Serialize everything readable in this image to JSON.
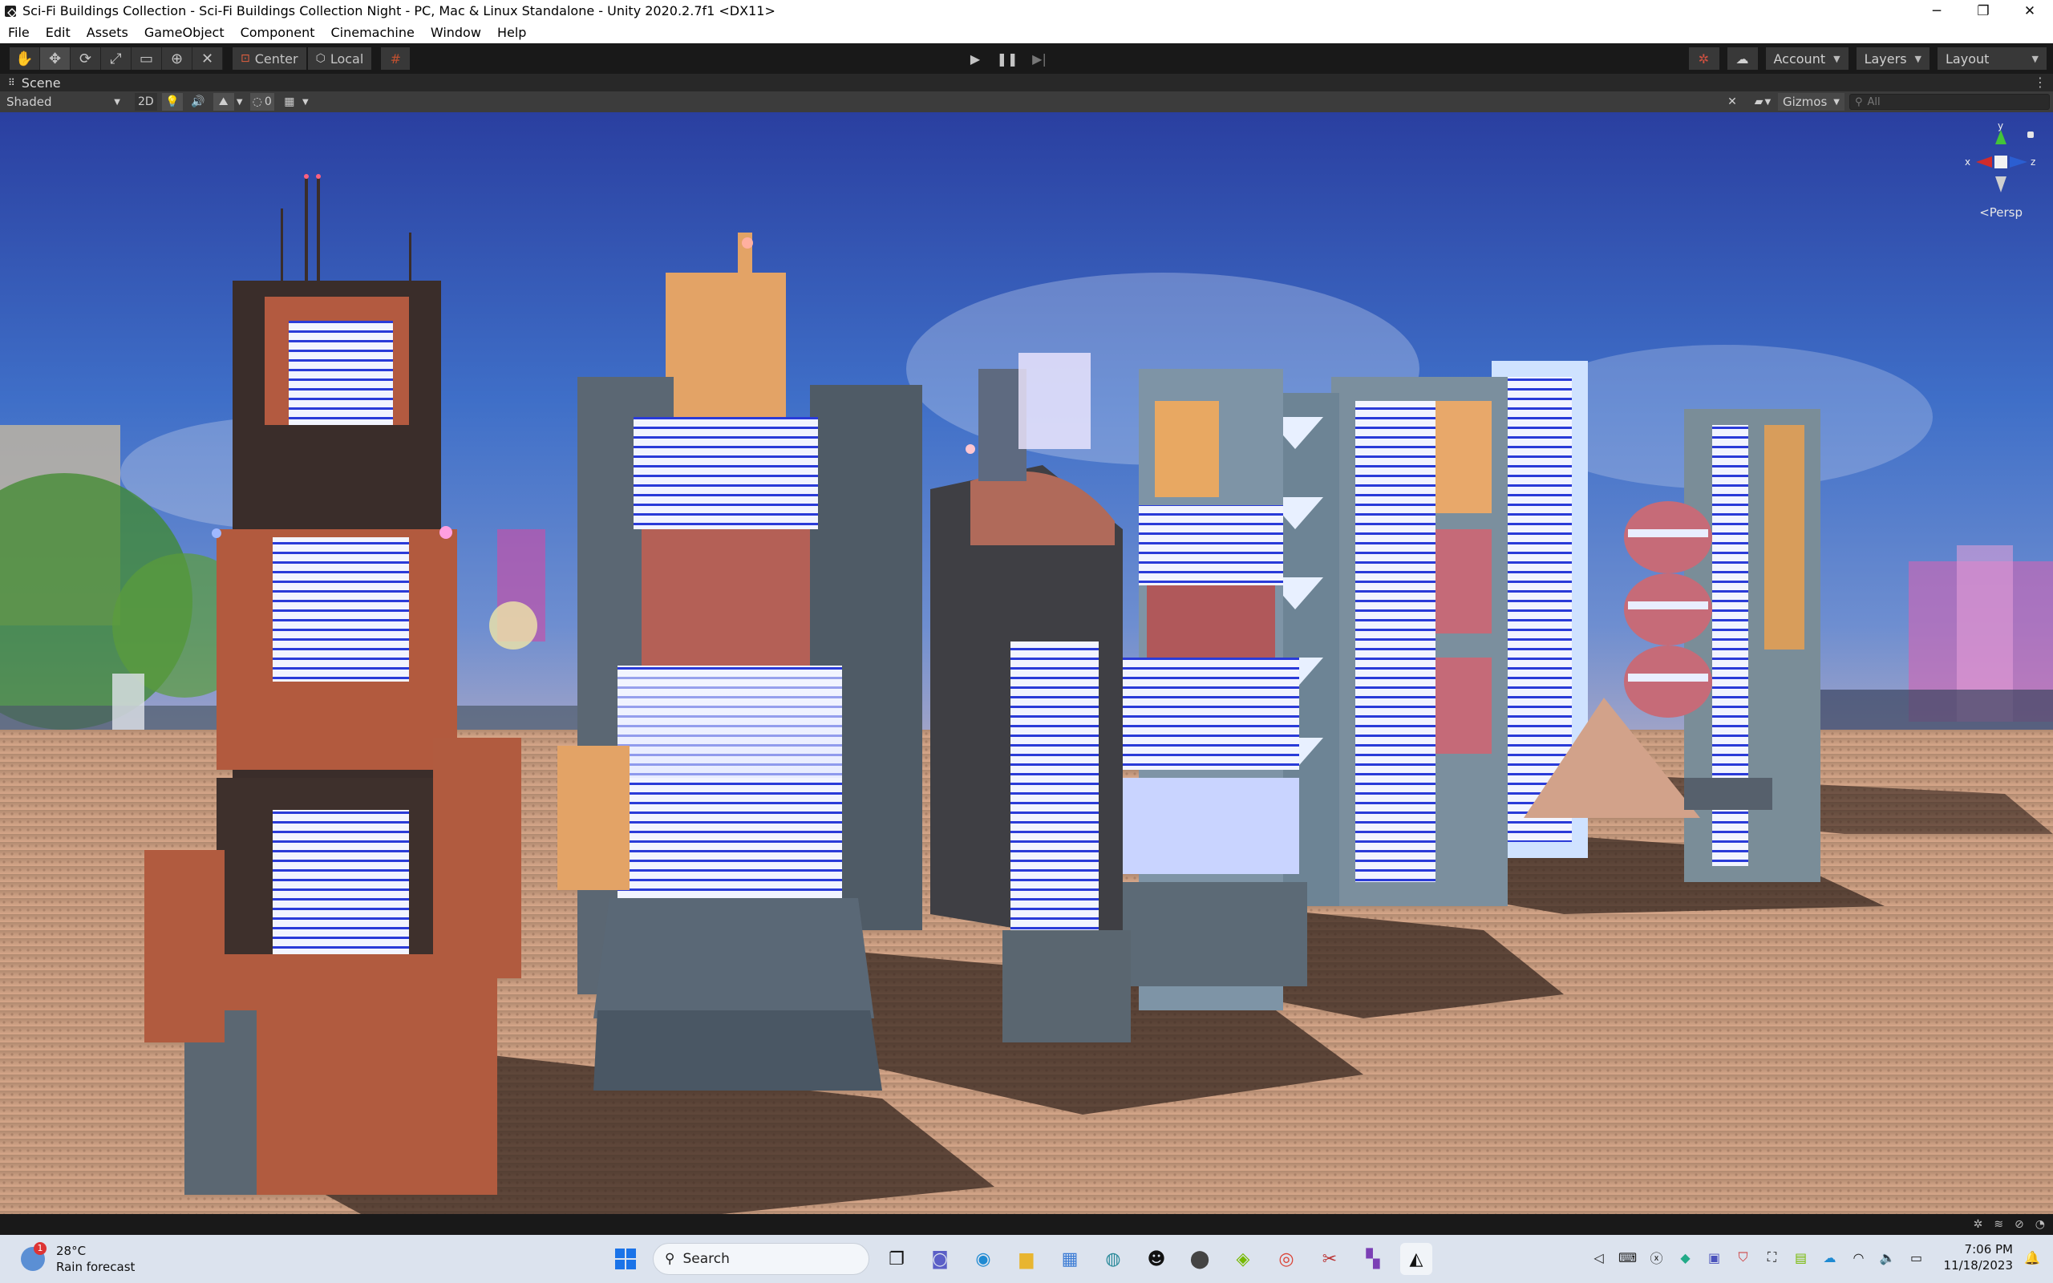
{
  "window": {
    "title": "Sci-Fi Buildings Collection - Sci-Fi Buildings Collection Night - PC, Mac & Linux Standalone - Unity 2020.2.7f1 <DX11>",
    "controls": {
      "minimize": "─",
      "maximize": "❐",
      "close": "✕"
    }
  },
  "menu": {
    "items": [
      "File",
      "Edit",
      "Assets",
      "GameObject",
      "Component",
      "Cinemachine",
      "Window",
      "Help"
    ]
  },
  "toolbar": {
    "tools": [
      {
        "name": "hand-tool",
        "icon": "✋",
        "active": false
      },
      {
        "name": "move-tool",
        "icon": "✥",
        "active": true
      },
      {
        "name": "rotate-tool",
        "icon": "⟳",
        "active": false
      },
      {
        "name": "scale-tool",
        "icon": "⤢",
        "active": false
      },
      {
        "name": "rect-tool",
        "icon": "▭",
        "active": false
      },
      {
        "name": "transform-tool",
        "icon": "⊕",
        "active": false
      },
      {
        "name": "custom-tool",
        "icon": "✕",
        "active": false
      }
    ],
    "pivot_label": "Center",
    "space_label": "Local",
    "play": "▶",
    "pause": "❚❚",
    "step": "▶|",
    "account_label": "Account",
    "layers_label": "Layers",
    "layout_label": "Layout"
  },
  "scene": {
    "tab_label": "Scene",
    "shading_mode": "Shaded",
    "mode_2d": "2D",
    "hidden_count": "0",
    "gizmos_label": "Gizmos",
    "search_placeholder": "All",
    "projection_label": "<Persp",
    "axes": {
      "x": "x",
      "y": "y",
      "z": "z"
    },
    "colors": {
      "axis_x": "#d12b2b",
      "axis_y": "#43c43a",
      "axis_z": "#2b5ed1"
    }
  },
  "taskbar": {
    "weather": {
      "temp": "28°C",
      "forecast": "Rain forecast",
      "badge": "1"
    },
    "search_label": "Search",
    "time": "7:06 PM",
    "date": "11/18/2023"
  }
}
